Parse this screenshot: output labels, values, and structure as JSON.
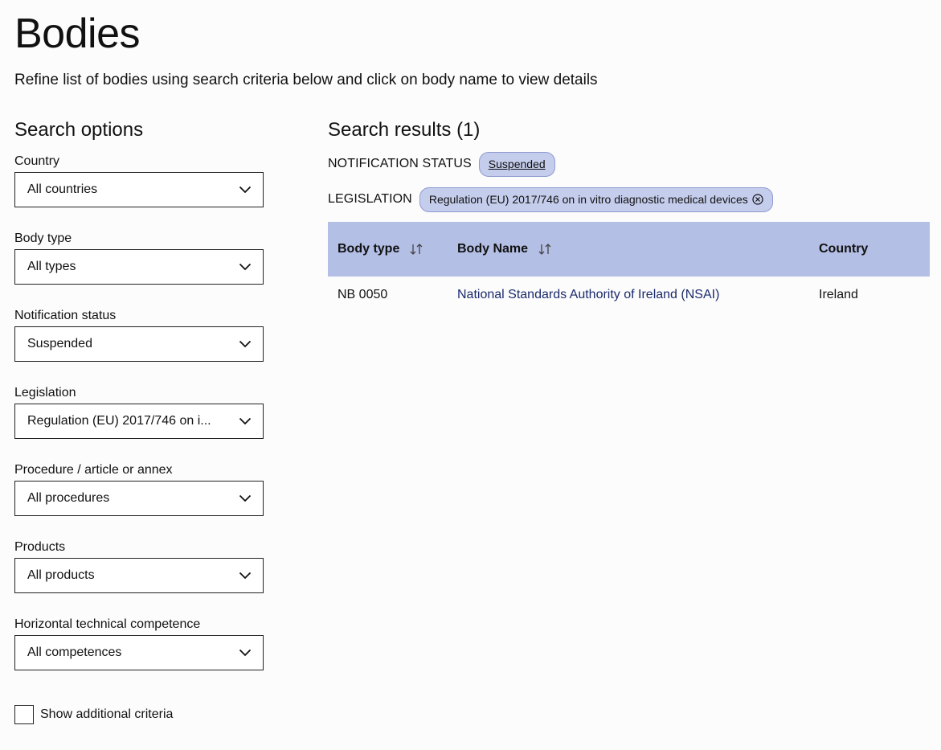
{
  "header": {
    "title": "Bodies",
    "subtitle": "Refine list of bodies using search criteria below and click on body name to view details"
  },
  "sidebar": {
    "title": "Search options",
    "fields": [
      {
        "label": "Country",
        "value": "All countries"
      },
      {
        "label": "Body type",
        "value": "All types"
      },
      {
        "label": "Notification status",
        "value": "Suspended"
      },
      {
        "label": "Legislation",
        "value": "Regulation (EU) 2017/746 on i..."
      },
      {
        "label": "Procedure / article or annex",
        "value": "All procedures"
      },
      {
        "label": "Products",
        "value": "All products"
      },
      {
        "label": "Horizontal technical competence",
        "value": "All competences"
      }
    ],
    "checkbox_label": "Show additional criteria"
  },
  "results": {
    "title": "Search results (1)",
    "filters": [
      {
        "key": "NOTIFICATION STATUS",
        "chip": "Suspended"
      },
      {
        "key": "LEGISLATION",
        "chip": "Regulation (EU) 2017/746 on in vitro diagnostic medical devices"
      }
    ],
    "table": {
      "headers": [
        "Body type",
        "Body Name",
        "Country"
      ],
      "rows": [
        [
          "NB 0050",
          "National Standards Authority of Ireland (NSAI)",
          "Ireland"
        ]
      ]
    }
  },
  "colors": {
    "chip_bg": "#c5cdec",
    "table_header_bg": "#b4bfe6",
    "link": "#1a2a6c"
  }
}
